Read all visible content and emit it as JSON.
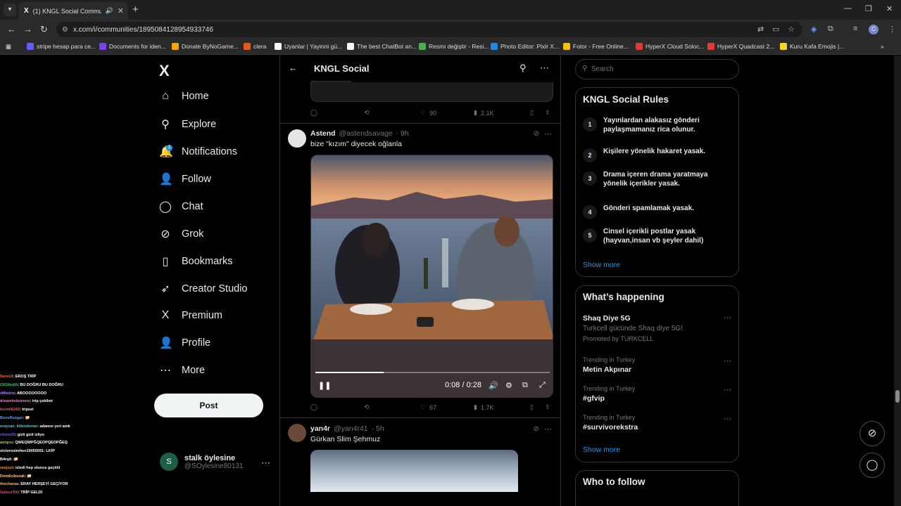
{
  "browser": {
    "tab_title": "(1) KNGL Social Community",
    "url": "x.com/i/communities/1895084128954933746",
    "bookmarks": [
      {
        "label": "stripe hesap para ce...",
        "color": "#635bff"
      },
      {
        "label": "Documents for iden...",
        "color": "#7e3ff2"
      },
      {
        "label": "Donate ByNoGame...",
        "color": "#f2a900"
      },
      {
        "label": "clera",
        "color": "#e8591a"
      },
      {
        "label": "Uyanlar | Yayinni gü...",
        "color": "#ffffff"
      },
      {
        "label": "The best ChatBot an...",
        "color": "#ffffff"
      },
      {
        "label": "Resmi değiştir - Resi...",
        "color": "#4caf50"
      },
      {
        "label": "Photo Editor: Pixlr X...",
        "color": "#1e88e5"
      },
      {
        "label": "Fotor - Free Online...",
        "color": "#fbbc05"
      },
      {
        "label": "HyperX Cloud Soloc...",
        "color": "#e53935"
      },
      {
        "label": "HyperX Quadcast 2...",
        "color": "#e53935"
      },
      {
        "label": "Kuru Kafa Emojis |...",
        "color": "#f9d71c"
      }
    ]
  },
  "sidebar": {
    "items": [
      {
        "label": "Home",
        "icon": "home-icon",
        "glyph": "⌂"
      },
      {
        "label": "Explore",
        "icon": "search-icon",
        "glyph": "⚲"
      },
      {
        "label": "Notifications",
        "icon": "bell-icon",
        "glyph": "🔔"
      },
      {
        "label": "Follow",
        "icon": "follow-icon",
        "glyph": "👤"
      },
      {
        "label": "Chat",
        "icon": "chat-icon",
        "glyph": "◯"
      },
      {
        "label": "Grok",
        "icon": "grok-icon",
        "glyph": "⊘"
      },
      {
        "label": "Bookmarks",
        "icon": "bookmark-icon",
        "glyph": "▯"
      },
      {
        "label": "Creator Studio",
        "icon": "rocket-icon",
        "glyph": "➶"
      },
      {
        "label": "Premium",
        "icon": "x-icon",
        "glyph": "X"
      },
      {
        "label": "Profile",
        "icon": "person-icon",
        "glyph": "👤"
      },
      {
        "label": "More",
        "icon": "more-circle-icon",
        "glyph": "⋯"
      }
    ],
    "notification_badge": "1",
    "post_button": "Post",
    "account": {
      "initial": "S",
      "name": "stalk öylesine",
      "handle": "@SOylesine80131"
    }
  },
  "center": {
    "title": "KNGL Social",
    "prev_stats": {
      "replies": "",
      "reposts": "",
      "likes": "90",
      "views": "2.1K"
    },
    "tweet1": {
      "name": "Astend",
      "handle": "@astendsavage",
      "time": "· 9h",
      "text": "bize \"kızım\" diyecek oğlanla",
      "video_time": "0:08 / 0:28",
      "video_progress": 0.29,
      "stats": {
        "replies": "",
        "reposts": "",
        "likes": "67",
        "views": "1.7K"
      }
    },
    "tweet2": {
      "name": "yan4r",
      "handle": "@yan4r41",
      "time": "· 5h",
      "text": "Gürkan Slim Şehmuz"
    }
  },
  "right": {
    "search_placeholder": "Search",
    "rules_title": "KNGL Social Rules",
    "rules": [
      {
        "num": "1",
        "text": "Yayınlardan alakasız gönderi paylaşmamanız rica olunur."
      },
      {
        "num": "2",
        "text": "Kişilere yönelik hakaret yasak."
      },
      {
        "num": "3",
        "text": "Drama içeren drama yaratmaya yönelik içerikler yasak."
      },
      {
        "num": "4",
        "text": "Gönderi spamlamak yasak."
      },
      {
        "num": "5",
        "text": "Cinsel içerikli postlar yasak (hayvan,insan vb şeyler dahil)"
      }
    ],
    "show_more": "Show more",
    "happening_title": "What’s happening",
    "trends": [
      {
        "meta": "",
        "title": "Shaq Diye 5G",
        "sub": "Turkcell gücünde Shaq diye 5G!",
        "promo": "Promoted by TURKCELL"
      },
      {
        "meta": "Trending in Turkey",
        "title": "Metin Akpınar",
        "sub": "",
        "promo": ""
      },
      {
        "meta": "Trending in Turkey",
        "title": "#gfvip",
        "sub": "",
        "promo": ""
      },
      {
        "meta": "Trending in Turkey",
        "title": "#survivorekstra",
        "sub": "",
        "promo": ""
      }
    ],
    "show_more_2": "Show more",
    "who_to_follow": "Who to follow"
  },
  "chat_overlay": [
    {
      "user": "Sero14",
      "msg": ": EROŞ TRİP",
      "color": "#ff6a3d"
    },
    {
      "user": "CEGhub5",
      "msg": ": BU DOĞRU BU DOĞRU",
      "color": "#2ecc71"
    },
    {
      "user": "vMistrix",
      "msg": ": ABOOOOOOOO",
      "color": "#b388ff"
    },
    {
      "user": "dreamindemonx",
      "msg": ": trip çekilmi",
      "color": "#ff7ab8"
    },
    {
      "user": "kozmik242",
      "msg": ": tripsel",
      "color": "#ff5252"
    },
    {
      "user": "BossRuzgar",
      "msg": ": 🐖",
      "color": "#5c9dff"
    },
    {
      "user": "eraycan_kibriskenar",
      "msg": ": adamın yeri amk",
      "color": "#4dd0e1"
    },
    {
      "user": "ritmio05",
      "msg": ": gizli gizli izliyo",
      "color": "#7c4dff"
    },
    {
      "user": "aniqou",
      "msg": ": QWEQWPĞQEOPQEOPĞEQ",
      "color": "#9ccc65"
    },
    {
      "user": "victorosimhen19055091",
      "msg": ": LKİP",
      "color": "#ffffff"
    },
    {
      "user": "B4rq4",
      "msg": ": 🐖",
      "color": "#ffffff"
    },
    {
      "user": "zexjust",
      "msg": ": izledi hep olunca geçtiiii",
      "color": "#ff9800"
    },
    {
      "user": "Dom6ciburak",
      "msg": ": 🐖",
      "color": "#ffcc80"
    },
    {
      "user": "thecharaa",
      "msg": ": ERAY HERŞEYİ GEÇİYOR",
      "color": "#ffb74d"
    },
    {
      "user": "GalourTiti",
      "msg": ": TRİP GELDİ",
      "color": "#ff4081"
    }
  ]
}
